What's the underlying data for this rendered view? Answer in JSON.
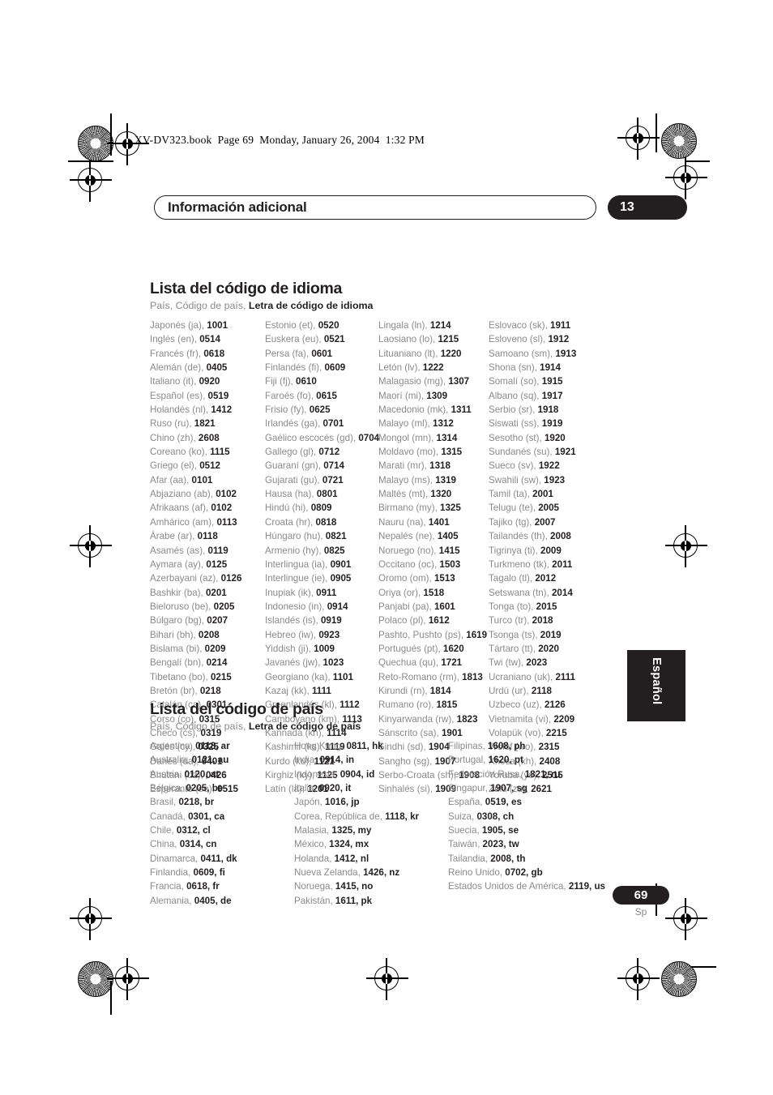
{
  "print_header": "XV-DV323.book  Page 69  Monday, January 26, 2004  1:32 PM",
  "chapter": {
    "title": "Información adicional",
    "number": "13"
  },
  "colors": {
    "ink": "#231f20",
    "muted": "#8a8a8a",
    "paper": "#ffffff"
  },
  "language_section": {
    "title": "Lista del código de idioma",
    "subtitle_plain": "País, Código de país, ",
    "subtitle_bold": "Letra de código de idioma",
    "columns": [
      [
        {
          "name": "Japonés (ja), ",
          "code": "1001"
        },
        {
          "name": "Inglés (en), ",
          "code": "0514"
        },
        {
          "name": "Francés (fr), ",
          "code": "0618"
        },
        {
          "name": "Alemán (de), ",
          "code": "0405"
        },
        {
          "name": "Italiano (it), ",
          "code": "0920"
        },
        {
          "name": "Español (es), ",
          "code": "0519"
        },
        {
          "name": "Holandés (nl), ",
          "code": "1412"
        },
        {
          "name": "Ruso (ru), ",
          "code": "1821"
        },
        {
          "name": "Chino (zh), ",
          "code": "2608"
        },
        {
          "name": "Coreano (ko), ",
          "code": "1115"
        },
        {
          "name": "Griego (el), ",
          "code": "0512"
        },
        {
          "name": "Afar (aa), ",
          "code": "0101"
        },
        {
          "name": "Abjaziano (ab), ",
          "code": "0102"
        },
        {
          "name": "Afrikaans (af), ",
          "code": "0102"
        },
        {
          "name": "Amhárico (am), ",
          "code": "0113"
        },
        {
          "name": "Árabe (ar), ",
          "code": "0118"
        },
        {
          "name": "Asamés (as), ",
          "code": "0119"
        },
        {
          "name": "Aymara (ay), ",
          "code": "0125"
        },
        {
          "name": "Azerbayani (az), ",
          "code": "0126"
        },
        {
          "name": "Bashkir (ba), ",
          "code": "0201"
        },
        {
          "name": "Bieloruso (be), ",
          "code": "0205"
        },
        {
          "name": "Búlgaro (bg), ",
          "code": "0207"
        },
        {
          "name": "Bihari (bh), ",
          "code": "0208"
        },
        {
          "name": "Bislama (bi), ",
          "code": "0209"
        },
        {
          "name": "Bengalí (bn), ",
          "code": "0214"
        },
        {
          "name": "Tibetano (bo), ",
          "code": "0215"
        },
        {
          "name": "Bretón (br), ",
          "code": "0218"
        },
        {
          "name": "Catalán (ca), ",
          "code": "0301"
        },
        {
          "name": "Corso (co), ",
          "code": "0315"
        },
        {
          "name": "Checo (cs), ",
          "code": "0319"
        },
        {
          "name": "Galés (cy), ",
          "code": "0325"
        },
        {
          "name": "Danés (da), ",
          "code": "0401"
        },
        {
          "name": "Bhutani (dz), ",
          "code": "0426"
        },
        {
          "name": "Esperanto (eo), ",
          "code": "0515"
        }
      ],
      [
        {
          "name": "Estonio (et), ",
          "code": "0520"
        },
        {
          "name": "Euskera (eu), ",
          "code": "0521"
        },
        {
          "name": "Persa (fa), ",
          "code": "0601"
        },
        {
          "name": "Finlandés (fi), ",
          "code": "0609"
        },
        {
          "name": "Fiji (fj), ",
          "code": "0610"
        },
        {
          "name": "Faroés (fo), ",
          "code": "0615"
        },
        {
          "name": "Frisio (fy), ",
          "code": "0625"
        },
        {
          "name": "Irlandés (ga), ",
          "code": "0701"
        },
        {
          "name": "Gaélico escocés (gd), ",
          "code": "0704"
        },
        {
          "name": "Gallego (gl), ",
          "code": "0712"
        },
        {
          "name": "Guaraní (gn), ",
          "code": "0714"
        },
        {
          "name": "Gujarati (gu), ",
          "code": "0721"
        },
        {
          "name": "Hausa (ha), ",
          "code": "0801"
        },
        {
          "name": "Hindú (hi), ",
          "code": "0809"
        },
        {
          "name": "Croata (hr), ",
          "code": "0818"
        },
        {
          "name": "Húngaro (hu), ",
          "code": "0821"
        },
        {
          "name": "Armenio (hy), ",
          "code": "0825"
        },
        {
          "name": "Interlingua (ia), ",
          "code": "0901"
        },
        {
          "name": "Interlingue (ie), ",
          "code": "0905"
        },
        {
          "name": "Inupiak (ik), ",
          "code": "0911"
        },
        {
          "name": "Indonesio (in), ",
          "code": "0914"
        },
        {
          "name": "Islandés (is), ",
          "code": "0919"
        },
        {
          "name": "Hebreo (iw), ",
          "code": "0923"
        },
        {
          "name": "Yiddish (ji), ",
          "code": "1009"
        },
        {
          "name": "Javanés (jw), ",
          "code": "1023"
        },
        {
          "name": "Georgiano (ka), ",
          "code": "1101"
        },
        {
          "name": "Kazaj (kk), ",
          "code": "1111"
        },
        {
          "name": "Greenlandés (kl), ",
          "code": "1112"
        },
        {
          "name": "Camboyano (km), ",
          "code": "1113"
        },
        {
          "name": "Kannada (kn), ",
          "code": "1114"
        },
        {
          "name": "Kashimir (ks), ",
          "code": "1119"
        },
        {
          "name": "Kurdo (ku), ",
          "code": "1121"
        },
        {
          "name": "Kirghiz (ky), ",
          "code": "1125"
        },
        {
          "name": "Latín (la), ",
          "code": "1201"
        }
      ],
      [
        {
          "name": "Lingala (ln), ",
          "code": "1214"
        },
        {
          "name": "Laosiano (lo), ",
          "code": "1215"
        },
        {
          "name": "Lituaniano (lt), ",
          "code": "1220"
        },
        {
          "name": "Letón (lv), ",
          "code": "1222"
        },
        {
          "name": "Malagasio (mg), ",
          "code": "1307"
        },
        {
          "name": "Maorí (mi), ",
          "code": "1309"
        },
        {
          "name": "Macedonio (mk), ",
          "code": "1311"
        },
        {
          "name": "Malayo (ml), ",
          "code": "1312"
        },
        {
          "name": "Mongol (mn), ",
          "code": "1314"
        },
        {
          "name": "Moldavo (mo), ",
          "code": "1315"
        },
        {
          "name": "Marati (mr), ",
          "code": "1318"
        },
        {
          "name": "Malayo (ms), ",
          "code": "1319"
        },
        {
          "name": "Maltés (mt), ",
          "code": "1320"
        },
        {
          "name": "Birmano (my), ",
          "code": "1325"
        },
        {
          "name": "Nauru (na), ",
          "code": "1401"
        },
        {
          "name": "Nepalés (ne), ",
          "code": "1405"
        },
        {
          "name": "Noruego (no), ",
          "code": "1415"
        },
        {
          "name": "Occitano (oc), ",
          "code": "1503"
        },
        {
          "name": "Oromo (om), ",
          "code": "1513"
        },
        {
          "name": "Oriya (or), ",
          "code": "1518"
        },
        {
          "name": "Panjabi (pa), ",
          "code": "1601"
        },
        {
          "name": "Polaco (pl), ",
          "code": "1612"
        },
        {
          "name": "Pashto, Pushto (ps), ",
          "code": "1619"
        },
        {
          "name": "Portugués (pt), ",
          "code": "1620"
        },
        {
          "name": "Quechua (qu), ",
          "code": "1721"
        },
        {
          "name": "Reto-Romano (rm), ",
          "code": "1813"
        },
        {
          "name": "Kirundi (rn), ",
          "code": "1814"
        },
        {
          "name": "Rumano (ro), ",
          "code": "1815"
        },
        {
          "name": "Kinyarwanda (rw), ",
          "code": "1823"
        },
        {
          "name": "Sánscrito (sa), ",
          "code": "1901"
        },
        {
          "name": "Sindhi (sd), ",
          "code": "1904"
        },
        {
          "name": "Sangho (sg), ",
          "code": "1907"
        },
        {
          "name": "Serbo-Croata (sh), ",
          "code": "1908"
        },
        {
          "name": "Sinhalés (si), ",
          "code": "1909"
        }
      ],
      [
        {
          "name": "Eslovaco (sk), ",
          "code": "1911"
        },
        {
          "name": "Esloveno (sl), ",
          "code": "1912"
        },
        {
          "name": "Samoano (sm), ",
          "code": "1913"
        },
        {
          "name": "Shona (sn), ",
          "code": "1914"
        },
        {
          "name": "Somalí (so), ",
          "code": "1915"
        },
        {
          "name": "Albano (sq), ",
          "code": "1917"
        },
        {
          "name": "Serbio (sr), ",
          "code": "1918"
        },
        {
          "name": "Siswati (ss), ",
          "code": "1919"
        },
        {
          "name": "Sesotho (st), ",
          "code": "1920"
        },
        {
          "name": "Sundanés (su), ",
          "code": "1921"
        },
        {
          "name": "Sueco (sv), ",
          "code": "1922"
        },
        {
          "name": "Swahili (sw), ",
          "code": "1923"
        },
        {
          "name": "Tamil (ta), ",
          "code": "2001"
        },
        {
          "name": "Telugu (te), ",
          "code": "2005"
        },
        {
          "name": "Tajiko (tg), ",
          "code": "2007"
        },
        {
          "name": "Tailandés (th), ",
          "code": "2008"
        },
        {
          "name": "Tigrinya (ti), ",
          "code": "2009"
        },
        {
          "name": "Turkmeno (tk), ",
          "code": "2011"
        },
        {
          "name": "Tagalo (tl), ",
          "code": "2012"
        },
        {
          "name": "Setswana (tn), ",
          "code": "2014"
        },
        {
          "name": "Tonga (to), ",
          "code": "2015"
        },
        {
          "name": "Turco (tr), ",
          "code": "2018"
        },
        {
          "name": "Tsonga (ts), ",
          "code": "2019"
        },
        {
          "name": "Tártaro (tt), ",
          "code": "2020"
        },
        {
          "name": "Twi (tw), ",
          "code": "2023"
        },
        {
          "name": "Ucraniano (uk), ",
          "code": "2111"
        },
        {
          "name": "Urdú (ur), ",
          "code": "2118"
        },
        {
          "name": "Uzbeco (uz), ",
          "code": "2126"
        },
        {
          "name": "Vietnamita (vi), ",
          "code": "2209"
        },
        {
          "name": "Volapük (vo), ",
          "code": "2215"
        },
        {
          "name": "Wolof (wo), ",
          "code": "2315"
        },
        {
          "name": "Xhosa (xh), ",
          "code": "2408"
        },
        {
          "name": "Yoruba (yo), ",
          "code": "2515"
        },
        {
          "name": "Zulú (zu), ",
          "code": "2621"
        }
      ]
    ]
  },
  "country_section": {
    "title": "Lista del código de país",
    "subtitle_plain": "País, Código de país, ",
    "subtitle_bold": "Letra de código de país",
    "columns": [
      [
        {
          "name": "Argentina, ",
          "code": "0118, ar"
        },
        {
          "name": "Australia, ",
          "code": "0121, au"
        },
        {
          "name": "Austria, ",
          "code": "0120, at"
        },
        {
          "name": "Bélgica, ",
          "code": "0205, be"
        },
        {
          "name": "Brasil, ",
          "code": "0218, br"
        },
        {
          "name": "Canadá, ",
          "code": "0301, ca"
        },
        {
          "name": "Chile, ",
          "code": "0312, cl"
        },
        {
          "name": "China, ",
          "code": "0314, cn"
        },
        {
          "name": "Dinamarca, ",
          "code": "0411, dk"
        },
        {
          "name": "Finlandia, ",
          "code": "0609, fi"
        },
        {
          "name": "Francia, ",
          "code": "0618, fr"
        },
        {
          "name": "Alemania, ",
          "code": "0405, de"
        }
      ],
      [
        {
          "name": "Hong Kong, ",
          "code": "0811, hk"
        },
        {
          "name": "India, ",
          "code": "0914, in"
        },
        {
          "name": "Indonesia, ",
          "code": "0904, id"
        },
        {
          "name": "Italia, ",
          "code": "0920, it"
        },
        {
          "name": "Japón, ",
          "code": "1016, jp"
        },
        {
          "name": "Corea, República de, ",
          "code": "1118, kr"
        },
        {
          "name": "Malasia, ",
          "code": "1325, my"
        },
        {
          "name": "México, ",
          "code": "1324, mx"
        },
        {
          "name": "Holanda, ",
          "code": "1412, nl"
        },
        {
          "name": "Nueva Zelanda, ",
          "code": "1426, nz"
        },
        {
          "name": "Noruega, ",
          "code": "1415, no"
        },
        {
          "name": "Pakistán, ",
          "code": "1611, pk"
        }
      ],
      [
        {
          "name": "Filipinas, ",
          "code": "1608, ph"
        },
        {
          "name": "Portugal, ",
          "code": "1620, pt"
        },
        {
          "name": "Federación Rusa, ",
          "code": "1821, ru"
        },
        {
          "name": "Singapur, ",
          "code": "1907, sg"
        },
        {
          "name": "España, ",
          "code": "0519, es"
        },
        {
          "name": "Suiza, ",
          "code": "0308, ch"
        },
        {
          "name": "Suecia, ",
          "code": "1905, se"
        },
        {
          "name": "Taiwán, ",
          "code": "2023, tw"
        },
        {
          "name": "Tailandia, ",
          "code": "2008, th"
        },
        {
          "name": "Reino Unido, ",
          "code": "0702, gb"
        },
        {
          "name": "Estados Unidos de América, ",
          "code": "2119, us"
        }
      ]
    ]
  },
  "side_tab": {
    "label": "Español"
  },
  "footer": {
    "page_number": "69",
    "language_mark": "Sp"
  }
}
